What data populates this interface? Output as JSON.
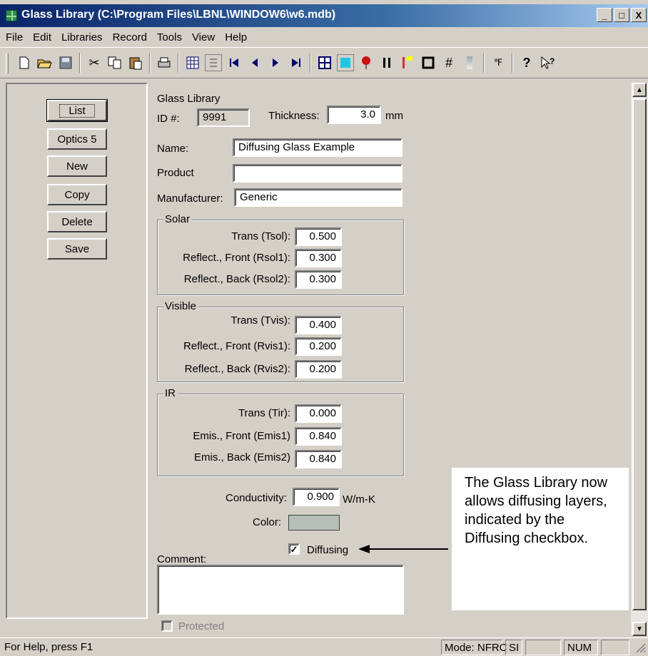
{
  "window": {
    "title": "Glass Library (C:\\Program Files\\LBNL\\WINDOW6\\w6.mdb)",
    "min_label": "_",
    "max_label": "□",
    "close_label": "X"
  },
  "menu": {
    "items": [
      "File",
      "Edit",
      "Libraries",
      "Record",
      "Tools",
      "View",
      "Help"
    ]
  },
  "toolbar": {
    "icons": [
      "new-file",
      "open-folder",
      "save-disk",
      "cut-scissors",
      "copy",
      "paste",
      "print",
      "grid-view",
      "list-view",
      "first-record",
      "prev-record",
      "next-record",
      "last-record",
      "table",
      "color",
      "balloon",
      "pause",
      "legend",
      "frame",
      "hash",
      "gradient",
      "temperature-units",
      "help",
      "context-help"
    ]
  },
  "left_buttons": {
    "list": "List",
    "optics": "Optics 5",
    "new": "New",
    "copy": "Copy",
    "delete": "Delete",
    "save": "Save"
  },
  "form": {
    "header": "Glass Library",
    "id_label": "ID #:",
    "id_value": "9991",
    "thickness_label": "Thickness:",
    "thickness_value": "3.0",
    "thickness_unit": "mm",
    "name_label": "Name:",
    "name_value": "Diffusing Glass Example",
    "product_label": "Product",
    "product_value": "",
    "manufacturer_label": "Manufacturer:",
    "manufacturer_value": "Generic",
    "solar": {
      "title": "Solar",
      "tsol_label": "Trans (Tsol):",
      "tsol_value": "0.500",
      "rsol1_label": "Reflect., Front (Rsol1):",
      "rsol1_value": "0.300",
      "rsol2_label": "Reflect., Back (Rsol2):",
      "rsol2_value": "0.300"
    },
    "visible": {
      "title": "Visible",
      "tvis_label": "Trans (Tvis):",
      "tvis_value": "0.400",
      "rvis1_label": "Reflect., Front (Rvis1):",
      "rvis1_value": "0.200",
      "rvis2_label": "Reflect., Back (Rvis2):",
      "rvis2_value": "0.200"
    },
    "ir": {
      "title": "IR",
      "tir_label": "Trans (Tir):",
      "tir_value": "0.000",
      "emis1_label": "Emis., Front (Emis1)",
      "emis1_value": "0.840",
      "emis2_label": "Emis., Back (Emis2)",
      "emis2_value": "0.840"
    },
    "conductivity_label": "Conductivity:",
    "conductivity_value": "0.900",
    "conductivity_unit": "W/m-K",
    "color_label": "Color:",
    "color_swatch": "#b5bfb6",
    "diffusing_label": "Diffusing",
    "diffusing_checked": true,
    "comment_label": "Comment:",
    "comment_value": "",
    "protected_label": "Protected",
    "protected_checked": false
  },
  "callout": {
    "text": "The Glass Library now allows diffusing layers, indicated by the Diffusing checkbox."
  },
  "statusbar": {
    "help": "For Help, press F1",
    "mode": "Mode: NFRC",
    "units": "SI",
    "num": "NUM"
  }
}
